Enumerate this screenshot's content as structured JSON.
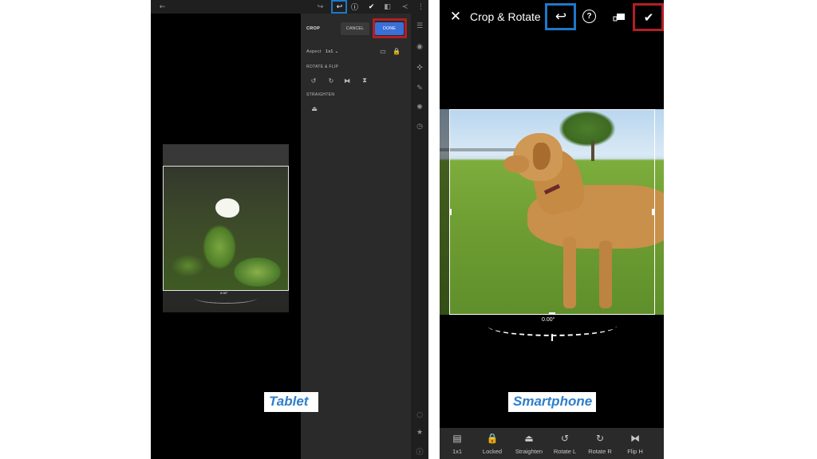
{
  "colors": {
    "highlight_blue": "#1f78c8",
    "highlight_red": "#b21f24",
    "done_button": "#3b6fd8",
    "caption_text": "#2f7fc9"
  },
  "tablet": {
    "caption": "Tablet",
    "topbar_icons": [
      "back-arrow-icon",
      "redo-icon",
      "undo-icon",
      "help-icon",
      "check-circle-icon",
      "compare-icon",
      "share-icon",
      "more-vertical-icon"
    ],
    "crop_panel": {
      "title": "CROP",
      "cancel_label": "CANCEL",
      "done_label": "DONE",
      "aspect_label": "Aspect",
      "aspect_value": "1x1",
      "rotate_flip_label": "ROTATE & FLIP",
      "straighten_label": "STRAIGHTEN"
    },
    "dial_value": "0.00°"
  },
  "phone": {
    "caption": "Smartphone",
    "title": "Crop & Rotate",
    "dial_value": "0.00°",
    "tools": [
      {
        "label": "1x1",
        "icon": "aspect-ratio-icon"
      },
      {
        "label": "Locked",
        "icon": "lock-icon"
      },
      {
        "label": "Straighten",
        "icon": "straighten-icon"
      },
      {
        "label": "Rotate L",
        "icon": "rotate-left-icon"
      },
      {
        "label": "Rotate R",
        "icon": "rotate-right-icon"
      },
      {
        "label": "Flip H",
        "icon": "flip-horizontal-icon"
      }
    ]
  }
}
